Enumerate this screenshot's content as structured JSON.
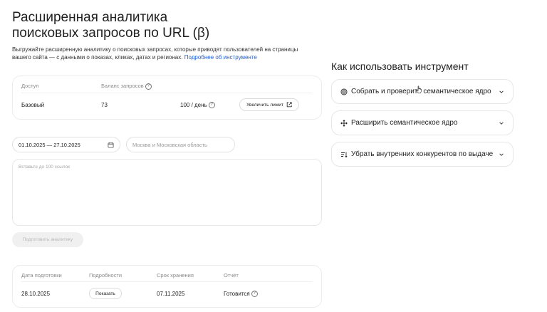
{
  "page": {
    "title_line1": "Расширенная аналитика",
    "title_line2": "поисковых запросов по URL (β)",
    "description": "Выгружайте расширенную аналитику о поисковых запросах, которые приводят пользователей на страницы вашего сайта — с данными о показах, кликах, датах и регионах.",
    "more_link": "Подробнее об инструменте"
  },
  "quota": {
    "col_access": "Доступ",
    "col_balance": "Баланс запросов",
    "access_value": "Базовый",
    "balance_value": "73",
    "limit_value": "100 / день",
    "increase_button": "Увеличить лимит"
  },
  "form": {
    "date_range": "01.10.2025 — 27.10.2025",
    "region_placeholder": "Москва и Московская область",
    "urls_placeholder": "Вставьте до 100 ссылок",
    "prepare_button": "Подготовить аналитику"
  },
  "reports": {
    "headers": [
      "Дата подготовки",
      "Подробности",
      "Срок хранения",
      "Отчёт"
    ],
    "rows": [
      {
        "date": "28.10.2025",
        "details_button": "Показать",
        "storage": "07.11.2025",
        "status": "Готовится"
      }
    ]
  },
  "howto": {
    "title": "Как использовать инструмент",
    "items": [
      {
        "label": "Собрать и проверить семантическое ядро",
        "icon": "target-icon"
      },
      {
        "label": "Расширить семантическое ядро",
        "icon": "expand-arrows-icon"
      },
      {
        "label": "Убрать внутренних конкурентов по выдаче",
        "icon": "sort-icon"
      }
    ]
  },
  "colors": {
    "link": "#1a5cd8",
    "border": "#e7e7e7",
    "muted": "#8a8a8a"
  }
}
